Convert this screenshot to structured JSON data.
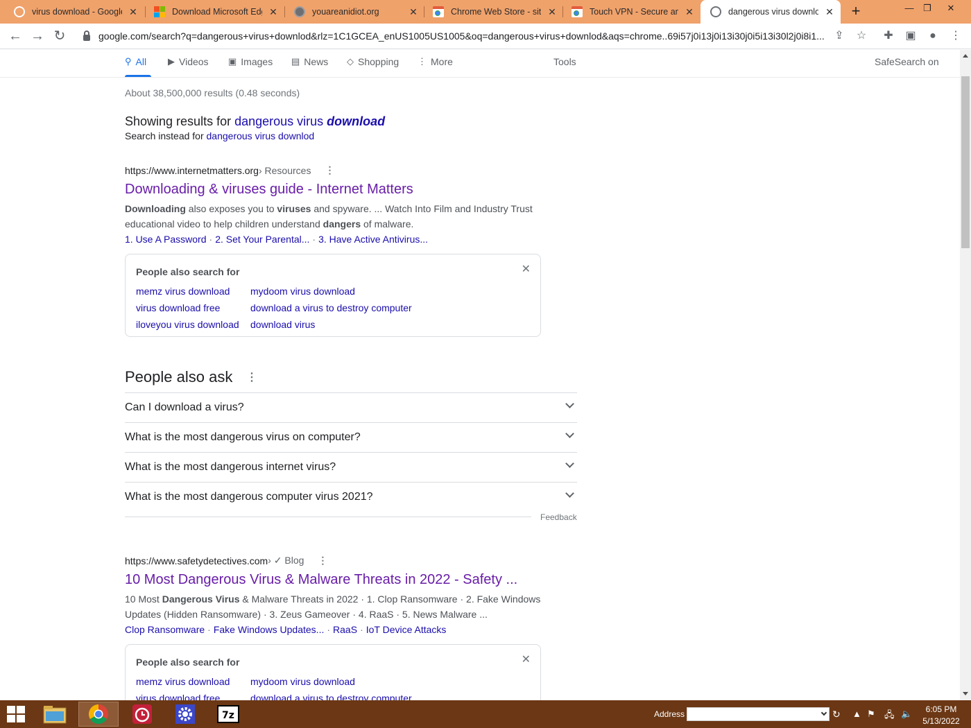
{
  "browser": {
    "tabs": [
      {
        "title": "virus download - Google",
        "favicon": "google-icon"
      },
      {
        "title": "Download Microsoft Edge",
        "favicon": "microsoft-icon"
      },
      {
        "title": "youareanidiot.org",
        "favicon": "globe-icon"
      },
      {
        "title": "Chrome Web Store - site",
        "favicon": "webstore-icon"
      },
      {
        "title": "Touch VPN - Secure and",
        "favicon": "webstore-icon"
      },
      {
        "title": "dangerous virus downlod",
        "favicon": "google-icon"
      }
    ],
    "active_tab": 5,
    "url": "google.com/search?q=dangerous+virus+downlod&rlz=1C1GCEA_enUS1005US1005&oq=dangerous+virus+downlod&aqs=chrome..69i57j0i13j0i13i30j0i5i13i30l2j0i8i1..."
  },
  "search_nav": {
    "tabs": [
      "All",
      "Videos",
      "Images",
      "News",
      "Shopping",
      "More"
    ],
    "tools": "Tools",
    "safesearch": "SafeSearch on"
  },
  "stats": "About 38,500,000 results (0.48 seconds)",
  "spelling": {
    "showing_prefix": "Showing results for ",
    "showing_plain": "dangerous virus ",
    "showing_corrected": "download",
    "instead_prefix": "Search instead for ",
    "instead_query": "dangerous virus downlod"
  },
  "results": [
    {
      "domain": "https://www.internetmatters.org",
      "breadcrumb": " › Resources",
      "title": "Downloading & viruses guide - Internet Matters",
      "snippet_html": "<b>Downloading</b> also exposes you to <b>viruses</b> and spyware. ... Watch Into Film and Industry Trust educational video to help children understand <b>dangers</b> of malware.",
      "sitelinks": [
        "1. Use A Password",
        "2. Set Your Parental...",
        "3. Have Active Antivirus..."
      ]
    },
    {
      "domain": "https://www.safetydetectives.com",
      "breadcrumb": " › ✓ Blog",
      "title": "10 Most Dangerous Virus & Malware Threats in 2022 - Safety ...",
      "snippet_html": "10 Most <b>Dangerous Virus</b> &amp; Malware Threats in 2022 · 1. Clop Ransomware · 2. Fake Windows Updates (Hidden Ransomware) · 3. Zeus Gameover · 4. RaaS · 5. News Malware ...",
      "sitelinks": [
        "Clop Ransomware",
        "Fake Windows Updates...",
        "RaaS",
        "IoT Device Attacks"
      ]
    }
  ],
  "people_also_search": {
    "title": "People also search for",
    "links": [
      "memz virus download",
      "mydoom virus download",
      "virus download free",
      "download a virus to destroy computer",
      "iloveyou virus download",
      "download virus"
    ]
  },
  "people_also_ask": {
    "title": "People also ask",
    "questions": [
      "Can I download a virus?",
      "What is the most dangerous virus on computer?",
      "What is the most dangerous internet virus?",
      "What is the most dangerous computer virus 2021?"
    ],
    "feedback": "Feedback"
  },
  "taskbar": {
    "address_label": "Address",
    "time": "6:05 PM",
    "date": "5/13/2022",
    "color": "#6b3714"
  },
  "colors": {
    "tabbar": "#f0a26b",
    "link": "#1a0dab",
    "visited": "#681da8",
    "accent": "#1a73e8"
  }
}
